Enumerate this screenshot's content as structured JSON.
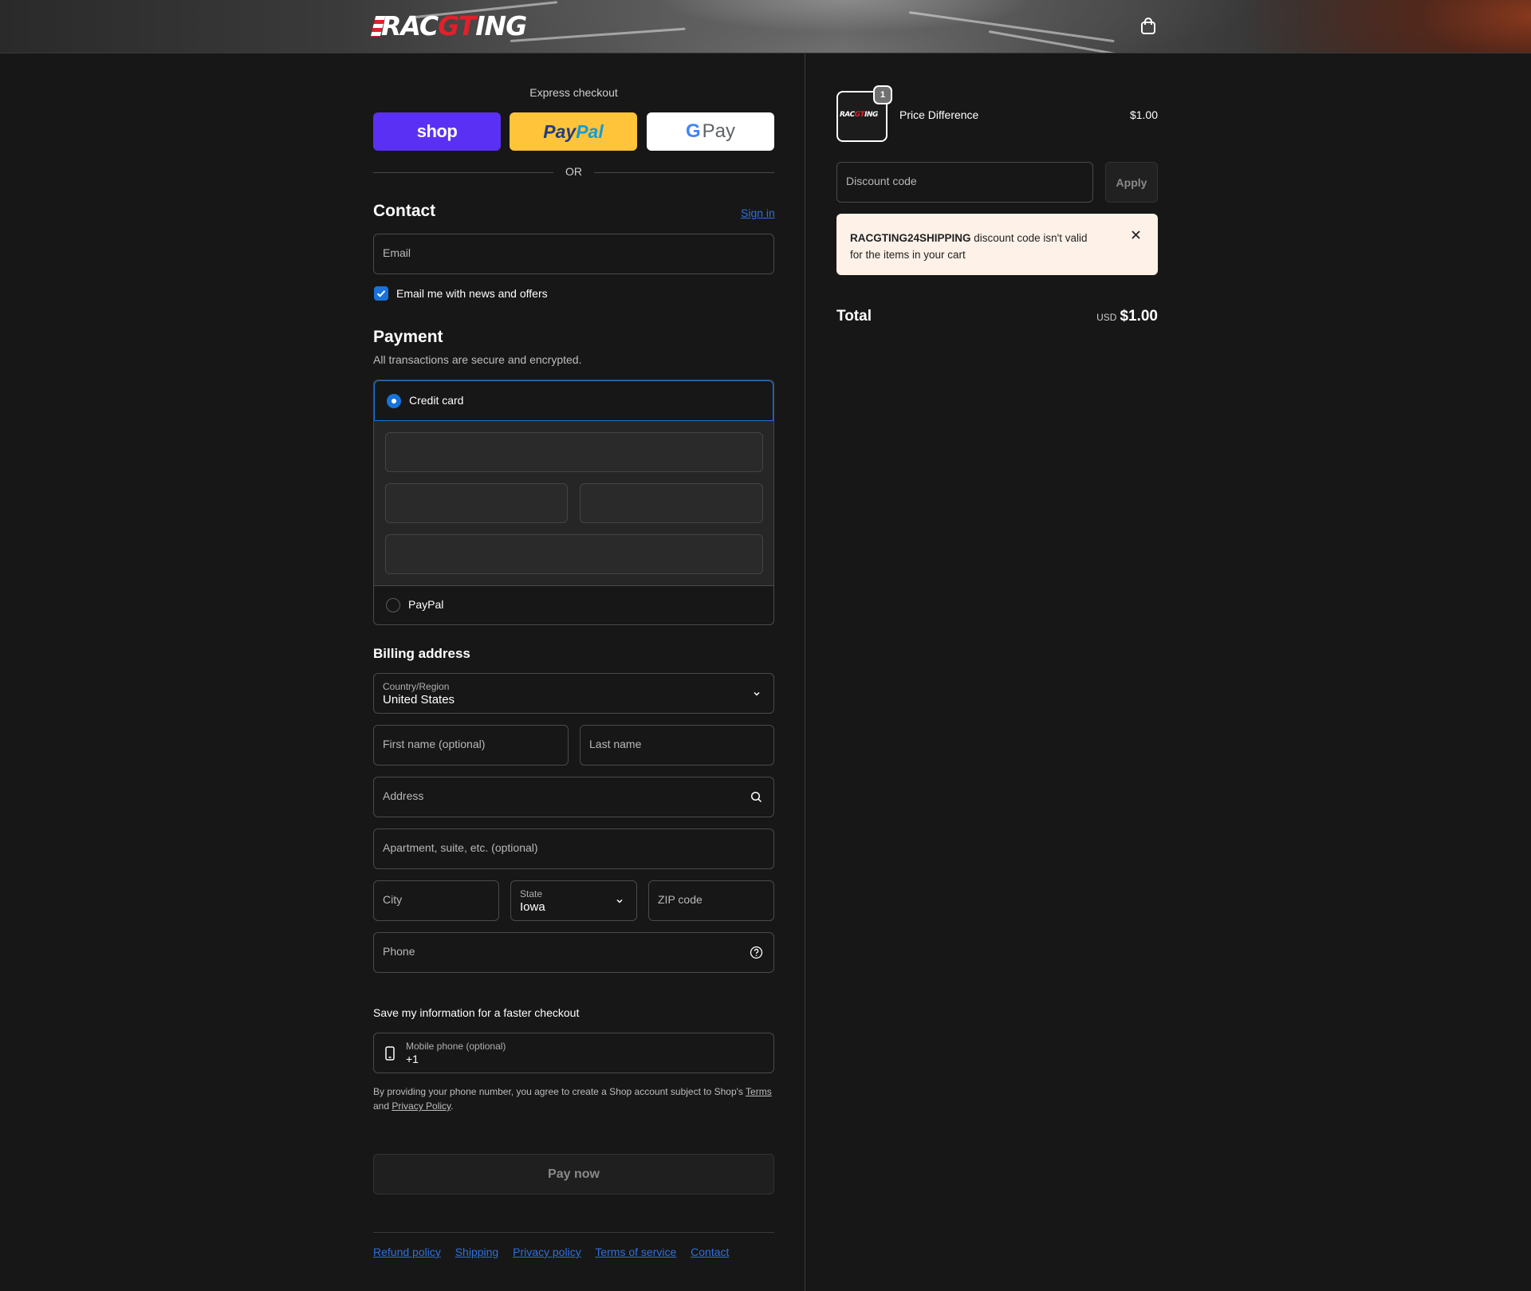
{
  "header": {
    "logo_text_a": "RAC",
    "logo_text_gt": "GT",
    "logo_text_b": "ING"
  },
  "express": {
    "title": "Express checkout",
    "shop_label": "shop",
    "paypal_label_a": "Pay",
    "paypal_label_b": "Pal",
    "gpay_g": "G",
    "gpay_label": "Pay",
    "or_label": "OR"
  },
  "contact": {
    "title": "Contact",
    "signin": "Sign in",
    "email_placeholder": "Email",
    "news_label": "Email me with news and offers",
    "news_checked": true
  },
  "payment": {
    "title": "Payment",
    "subtitle": "All transactions are secure and encrypted.",
    "options": [
      {
        "label": "Credit card",
        "selected": true
      },
      {
        "label": "PayPal",
        "selected": false
      }
    ]
  },
  "billing": {
    "title": "Billing address",
    "country_label": "Country/Region",
    "country_value": "United States",
    "first_name": "First name (optional)",
    "last_name": "Last name",
    "address": "Address",
    "apartment": "Apartment, suite, etc. (optional)",
    "city": "City",
    "state_label": "State",
    "state_value": "Iowa",
    "zip": "ZIP code",
    "phone": "Phone"
  },
  "save_info": {
    "title": "Save my information for a faster checkout",
    "mobile_label": "Mobile phone (optional)",
    "mobile_value": "+1",
    "disclaimer_a": "By providing your phone number, you agree to create a Shop account subject to Shop's",
    "terms": "Terms",
    "disclaimer_and": "and",
    "privacy": "Privacy Policy",
    "disclaimer_end": "."
  },
  "pay_now": "Pay now",
  "footer_links": [
    "Refund policy",
    "Shipping",
    "Privacy policy",
    "Terms of service",
    "Contact"
  ],
  "summary": {
    "item_qty": "1",
    "item_name": "Price Difference",
    "item_price": "$1.00",
    "thumb_a": "RAC",
    "thumb_gt": "GT",
    "thumb_b": "ING",
    "discount_placeholder": "Discount code",
    "apply_label": "Apply",
    "alert_code": "RACGTING24SHIPPING",
    "alert_text_a": "discount code isn't valid",
    "alert_text_b": "for the items in your cart",
    "total_label": "Total",
    "currency": "USD",
    "total_value": "$1.00"
  },
  "colors": {
    "shop": "#5a31f4",
    "paypal": "#ffc439",
    "link": "#2f6fe0",
    "alert_bg": "#fdf1e8",
    "accent": "#1773d9"
  }
}
